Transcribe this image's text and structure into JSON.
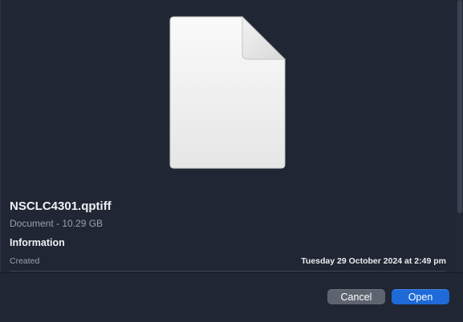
{
  "preview": {
    "icon": "generic-document-icon"
  },
  "file": {
    "name": "NSCLC4301.qptiff",
    "kind": "Document - 10.29 GB"
  },
  "info": {
    "section_title": "Information",
    "rows": [
      {
        "label": "Created",
        "value": "Tuesday 29 October 2024 at 2:49 pm"
      }
    ]
  },
  "buttons": {
    "cancel_label": "Cancel",
    "open_label": "Open"
  },
  "colors": {
    "background": "#202633",
    "primary_button": "#1d6ad8",
    "secondary_button": "#5d6470"
  }
}
